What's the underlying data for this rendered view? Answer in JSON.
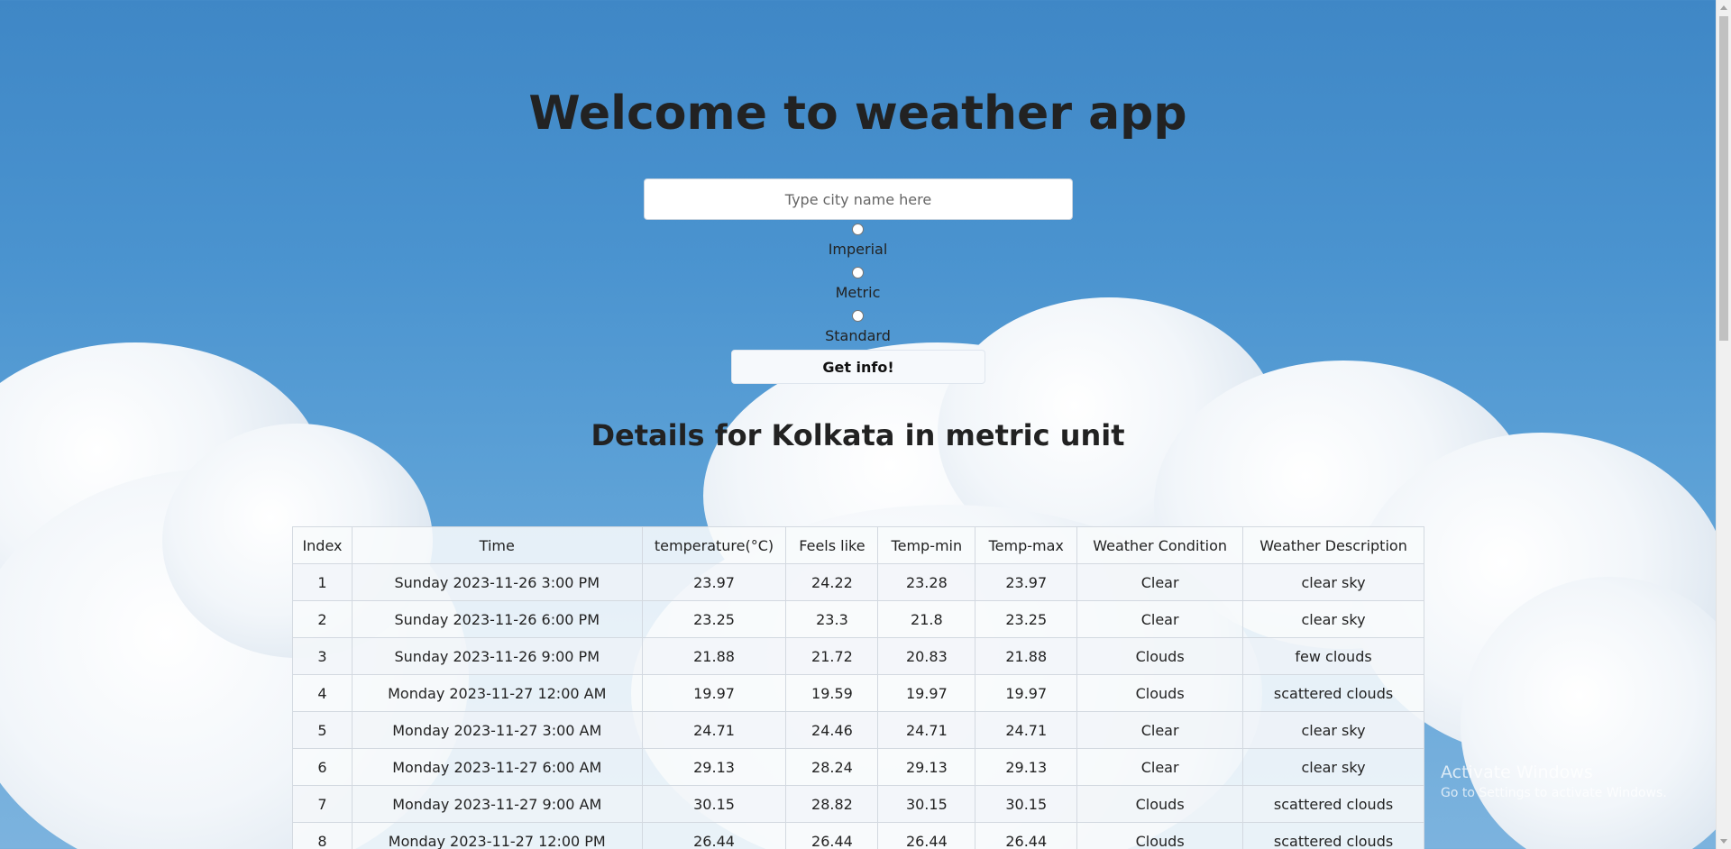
{
  "page": {
    "title": "Welcome to weather app",
    "search_placeholder": "Type city name here",
    "units": [
      {
        "label": "Imperial"
      },
      {
        "label": "Metric"
      },
      {
        "label": "Standard"
      }
    ],
    "submit_label": "Get info!",
    "details_heading": "Details for Kolkata in metric unit"
  },
  "table": {
    "headers": [
      "Index",
      "Time",
      "temperature(°C)",
      "Feels like",
      "Temp-min",
      "Temp-max",
      "Weather Condition",
      "Weather Description"
    ],
    "rows": [
      [
        "1",
        "Sunday 2023-11-26 3:00 PM",
        "23.97",
        "24.22",
        "23.28",
        "23.97",
        "Clear",
        "clear sky"
      ],
      [
        "2",
        "Sunday 2023-11-26 6:00 PM",
        "23.25",
        "23.3",
        "21.8",
        "23.25",
        "Clear",
        "clear sky"
      ],
      [
        "3",
        "Sunday 2023-11-26 9:00 PM",
        "21.88",
        "21.72",
        "20.83",
        "21.88",
        "Clouds",
        "few clouds"
      ],
      [
        "4",
        "Monday 2023-11-27 12:00 AM",
        "19.97",
        "19.59",
        "19.97",
        "19.97",
        "Clouds",
        "scattered clouds"
      ],
      [
        "5",
        "Monday 2023-11-27 3:00 AM",
        "24.71",
        "24.46",
        "24.71",
        "24.71",
        "Clear",
        "clear sky"
      ],
      [
        "6",
        "Monday 2023-11-27 6:00 AM",
        "29.13",
        "28.24",
        "29.13",
        "29.13",
        "Clear",
        "clear sky"
      ],
      [
        "7",
        "Monday 2023-11-27 9:00 AM",
        "30.15",
        "28.82",
        "30.15",
        "30.15",
        "Clouds",
        "scattered clouds"
      ],
      [
        "8",
        "Monday 2023-11-27 12:00 PM",
        "26.44",
        "26.44",
        "26.44",
        "26.44",
        "Clouds",
        "scattered clouds"
      ]
    ]
  },
  "watermark": {
    "line1": "Activate Windows",
    "line2": "Go to Settings to activate Windows."
  },
  "colors": {
    "sky_top": "#3f87c6",
    "sky_bottom": "#7cb3de",
    "text": "#222222"
  }
}
